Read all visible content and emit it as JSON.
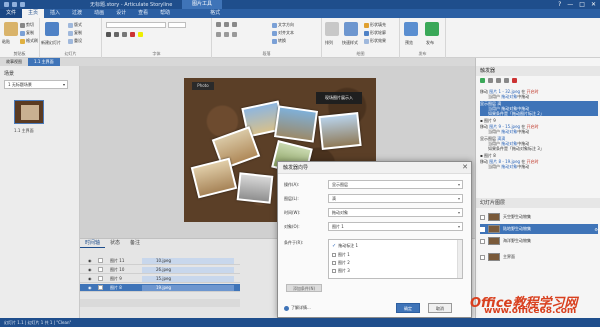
{
  "titlebar": {
    "title": "无标题.story - Articulate Storyline",
    "tools_tab": "图片工具",
    "win_buttons": [
      "?",
      "—",
      "□",
      "✕"
    ]
  },
  "menu": {
    "tabs": [
      "文件",
      "主页",
      "插入",
      "过渡",
      "动画",
      "设计",
      "查看",
      "帮助",
      "格式"
    ]
  },
  "ribbon": {
    "clipboard": {
      "label": "剪贴板",
      "cut": "剪切",
      "copy": "复制",
      "paste_format": "格式刷",
      "paste": "粘贴"
    },
    "slide": {
      "label": "幻灯片",
      "new_slide": "新建幻灯片",
      "layout": "版式",
      "duplicate": "复制",
      "reset": "重设"
    },
    "font": {
      "label": "字体"
    },
    "paragraph": {
      "label": "段落",
      "text_dir": "文字方向",
      "align": "对齐文本",
      "smartart": "转换"
    },
    "drawing": {
      "label": "绘图",
      "fill": "形状填充",
      "outline": "形状轮廓",
      "effect": "形状效果",
      "arrange": "排列",
      "quick_styles": "快速样式"
    },
    "publish": {
      "label": "发布",
      "preview": "预览",
      "publish": "发布"
    }
  },
  "tabbar": {
    "story_view": "故事视图",
    "slide_tab": "1.1 主界面"
  },
  "scene": {
    "header": "场景",
    "dropdown": "1 无标题场景",
    "thumb_label": "1.1 主界面"
  },
  "slide": {
    "logo": "Photo",
    "title_box": "现场图片展示入"
  },
  "timeline": {
    "tabs": [
      "时间轴",
      "状态",
      "备注"
    ],
    "rows": [
      {
        "name": "图片 11",
        "bar": "10.jpeg",
        "selected": false
      },
      {
        "name": "图片 10",
        "bar": "26.jpeg",
        "selected": false
      },
      {
        "name": "图片 9",
        "bar": "15.jpeg",
        "selected": false
      },
      {
        "name": "图片 8",
        "bar": "19.jpeg",
        "selected": true
      }
    ]
  },
  "status": {
    "text": "幻灯片 1.1 | 幻灯片 1 共 1 | \"Clean\""
  },
  "triggers": {
    "header": "触发器",
    "items": [
      {
        "main_pre": "移动",
        "main_link": "图片 1 - 32.jpeg",
        "main_mid": "在",
        "main_red": "开启时",
        "sub_pre": "当用户",
        "sub_link": "拖动对象",
        "sub_post": "中拖动",
        "selected": false
      },
      {
        "main_pre": "显示图层",
        "main_link": "滴",
        "main_mid": "",
        "main_red": "",
        "sub_pre": "当用户",
        "sub_link": "拖动对象",
        "sub_post": "中拖动",
        "sub2": "如果条件是「拖动图片标注 2」",
        "selected": true
      },
      {
        "main_pre": "图片 9",
        "main_link": "",
        "main_mid": "",
        "main_red": "",
        "sub_pre": "",
        "sub_link": "",
        "sub_post": "",
        "selected": false
      },
      {
        "main_pre": "移动",
        "main_link": "图片 9 - 15.jpeg",
        "main_mid": "在",
        "main_red": "开启时",
        "sub_pre": "当用户",
        "sub_link": "拖动对象",
        "sub_post": "中拖动",
        "selected": false
      },
      {
        "main_pre": "显示图层",
        "main_link": "滴滴",
        "main_mid": "",
        "main_red": "",
        "sub_pre": "当用户",
        "sub_link": "拖动对象",
        "sub_post": "中拖动",
        "sub2": "如果条件是「拖动对象标注 3」",
        "selected": false
      },
      {
        "main_pre": "图片 8",
        "main_link": "",
        "main_mid": "",
        "main_red": "",
        "sub_pre": "",
        "sub_link": "",
        "sub_post": "",
        "selected": false
      },
      {
        "main_pre": "移动",
        "main_link": "图片 8 - 19.jpeg",
        "main_mid": "在",
        "main_red": "开启时",
        "sub_pre": "当用户",
        "sub_link": "拖动对象",
        "sub_post": "中拖动",
        "selected": false
      }
    ]
  },
  "layers": {
    "header": "幻灯片图层",
    "items": [
      {
        "name": "天空野生动物集",
        "selected": false
      },
      {
        "name": "陆地野生动物集",
        "selected": true
      },
      {
        "name": "海洋野生动物集",
        "selected": false
      },
      {
        "name": "主界面",
        "selected": false
      }
    ]
  },
  "dialog": {
    "title": "触发器向导",
    "close": "✕",
    "fields": [
      {
        "label": "操作(A):",
        "value": "显示图层"
      },
      {
        "label": "图层(L):",
        "value": "滴"
      },
      {
        "label": "时间(W):",
        "value": "拖动对象"
      },
      {
        "label": "对象(O):",
        "value": "图片 1"
      }
    ],
    "cond_label": "条件于(R):",
    "conditions": [
      {
        "label": "拖动标注 1",
        "checked": true
      },
      {
        "label": "图片 1",
        "checked": false
      },
      {
        "label": "图片 2",
        "checked": false
      },
      {
        "label": "图片 3",
        "checked": false
      }
    ],
    "add_condition": "添加条件(N)",
    "help": "了解详情...",
    "ok": "确定",
    "cancel": "取消"
  },
  "watermark": {
    "line1": "Office教程学习网",
    "line2": "www.office68.com"
  },
  "colors": {
    "accent": "#1f4e8c",
    "ribbon_tab": "#2b5fa3",
    "selection": "#3f74b8",
    "watermark": "#d9401f"
  }
}
